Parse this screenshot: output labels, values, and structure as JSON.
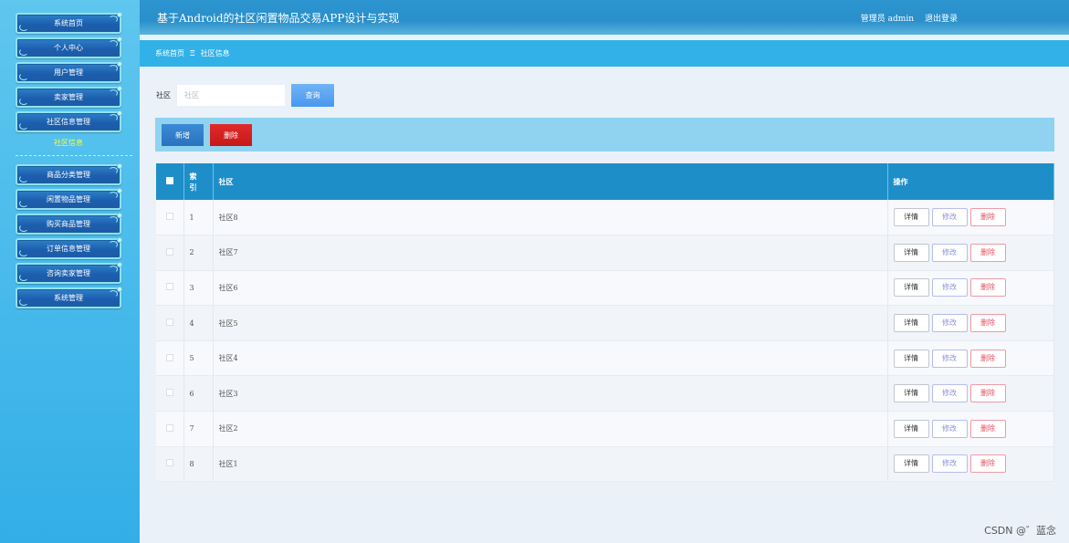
{
  "sidebar": {
    "items": [
      {
        "label": "系统首页"
      },
      {
        "label": "个人中心"
      },
      {
        "label": "用户管理"
      },
      {
        "label": "卖家管理"
      },
      {
        "label": "社区信息管理"
      },
      {
        "label": "商品分类管理"
      },
      {
        "label": "闲置物品管理"
      },
      {
        "label": "购买商品管理"
      },
      {
        "label": "订单信息管理"
      },
      {
        "label": "咨询卖家管理"
      },
      {
        "label": "系统管理"
      }
    ],
    "submenu_label": "社区信息"
  },
  "header": {
    "title": "基于Android的社区闲置物品交易APP设计与实现",
    "user": "管理员 admin",
    "logout": "退出登录"
  },
  "breadcrumb": {
    "home": "系统首页",
    "separator": "Ξ",
    "current": "社区信息"
  },
  "search": {
    "label": "社区",
    "placeholder": "社区",
    "button": "查询"
  },
  "actions": {
    "add": "新增",
    "delete": "删除"
  },
  "table": {
    "headers": {
      "index": "索\n引",
      "community": "社区",
      "operations": "操作"
    },
    "rows": [
      {
        "index": "1",
        "community": "社区8"
      },
      {
        "index": "2",
        "community": "社区7"
      },
      {
        "index": "3",
        "community": "社区6"
      },
      {
        "index": "4",
        "community": "社区5"
      },
      {
        "index": "5",
        "community": "社区4"
      },
      {
        "index": "6",
        "community": "社区3"
      },
      {
        "index": "7",
        "community": "社区2"
      },
      {
        "index": "8",
        "community": "社区1"
      }
    ],
    "row_ops": {
      "detail": "详情",
      "edit": "修改",
      "delete": "删除"
    }
  },
  "watermark": "CSDN @゛蓝念",
  "colors": {
    "sidebar": "#4bbcec",
    "header": "#2a8fcb",
    "breadcrumb": "#32b1e8",
    "table_header": "#1e8ec8",
    "add_button": "#2a72bd",
    "delete_button": "#c61818"
  }
}
